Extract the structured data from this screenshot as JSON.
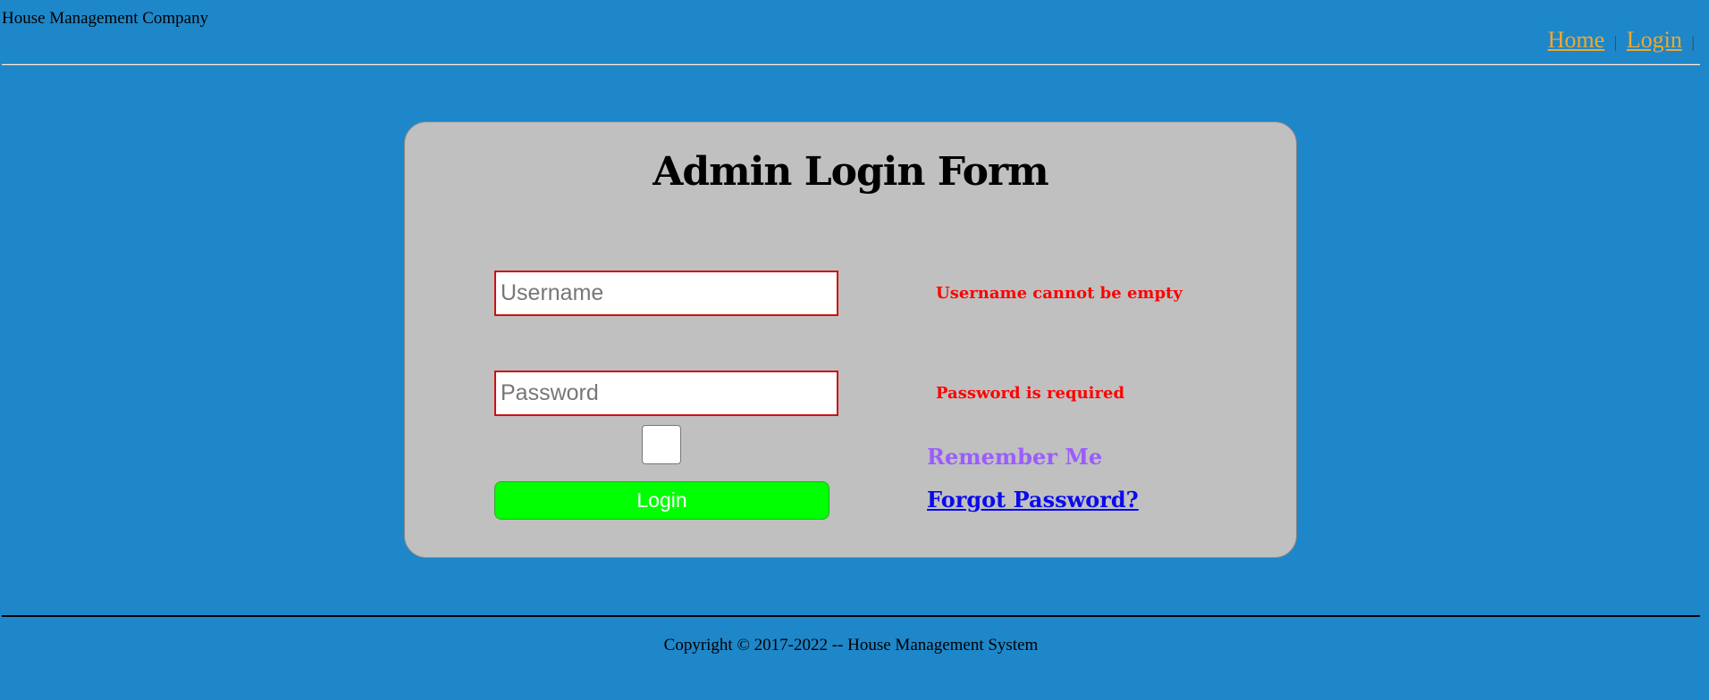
{
  "header": {
    "company_name": "House Management Company",
    "nav": {
      "home": "Home",
      "login": "Login",
      "separator": "|"
    }
  },
  "form": {
    "title": "Admin Login Form",
    "username": {
      "placeholder": "Username",
      "value": "",
      "error": "Username cannot be empty"
    },
    "password": {
      "placeholder": "Password",
      "value": "",
      "error": "Password is required"
    },
    "remember_me": {
      "label": "Remember Me",
      "checked": false
    },
    "login_button": "Login",
    "forgot_password": "Forgot Password?"
  },
  "footer": {
    "copyright": "Copyright © 2017-2022 -- House Management System"
  },
  "colors": {
    "page_background": "#1e87c9",
    "panel_background": "#c0c0c0",
    "nav_link": "#f0a830",
    "error_text": "#ff0000",
    "remember_text": "#9b5cff",
    "forgot_link": "#0a0aee",
    "login_button": "#00ff00",
    "field_border": "#cc1010"
  }
}
